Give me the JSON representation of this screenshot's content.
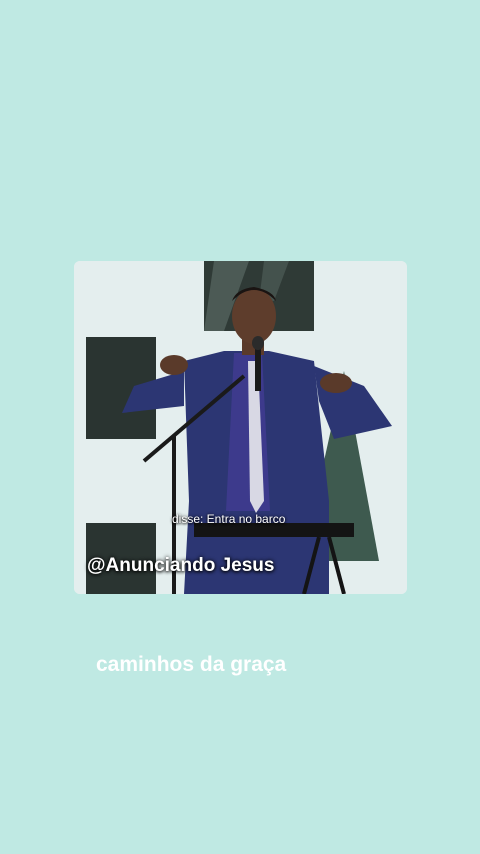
{
  "media": {
    "subtitle": "disse: Entra no barco",
    "watermark_handle": "@Anunciando Jesus"
  },
  "footer": {
    "title": "caminhos da graça"
  },
  "colors": {
    "background": "#bfe9e3",
    "text": "#ffffff"
  }
}
